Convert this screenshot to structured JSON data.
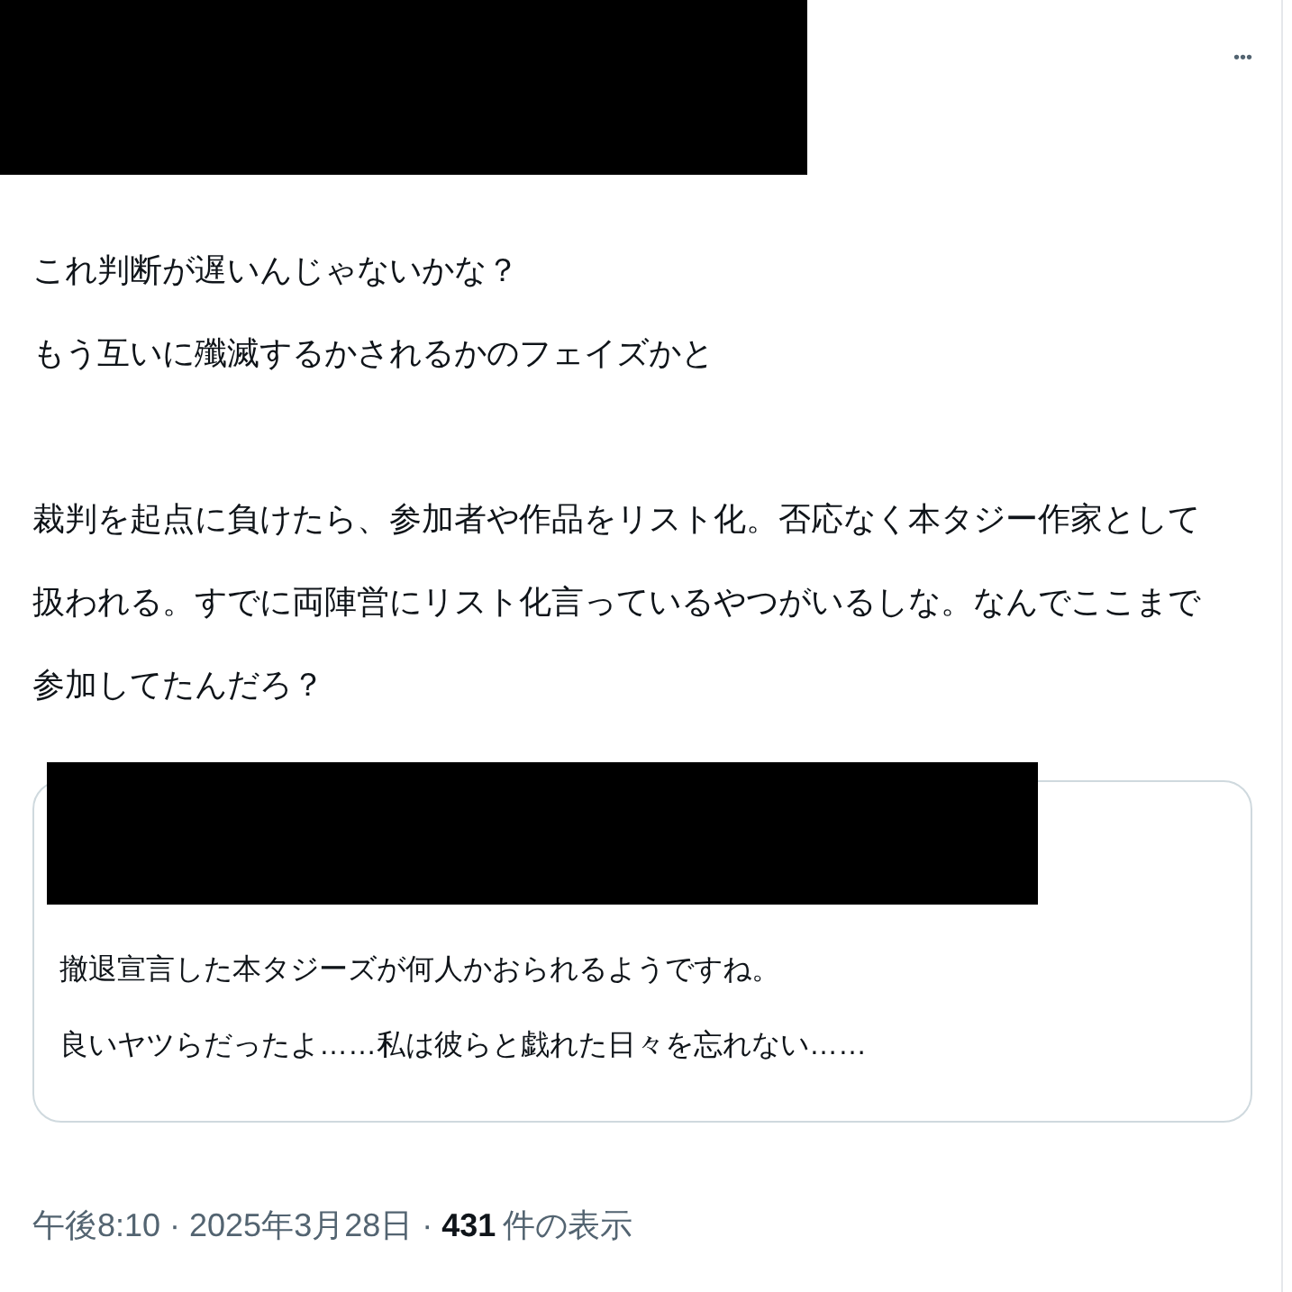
{
  "post": {
    "more_button": "•••",
    "paragraphs": [
      [
        "これ判断が遅いんじゃないかな？",
        "もう互いに殲滅するかされるかのフェイズかと"
      ],
      [
        "裁判を起点に負けたら、参加者や作品をリスト化。否応なく本タジー作家として",
        "扱われる。すでに両陣営にリスト化言っているやつがいるしな。なんでここまで",
        "参加してたんだろ？"
      ]
    ],
    "quote": {
      "lines": [
        "撤退宣言した本タジーズが何人かおられるようですね。",
        "良いヤツらだったよ……私は彼らと戯れた日々を忘れない……"
      ]
    },
    "meta": {
      "time_date": "午後8:10 · 2025年3月28日 · ",
      "views_count": "431",
      "views_label": "件の表示"
    }
  }
}
